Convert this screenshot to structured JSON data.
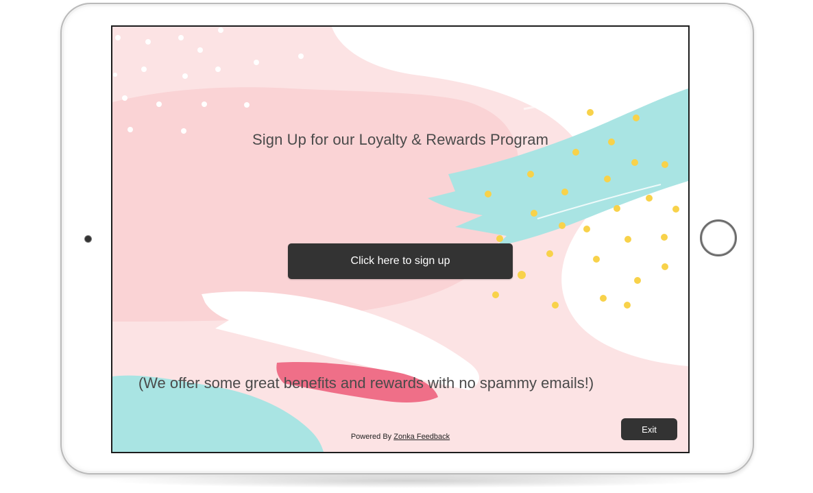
{
  "survey": {
    "title": "Sign Up for our Loyalty & Rewards Program",
    "cta_label": "Click here to sign up",
    "note": "(We offer some great benefits and rewards with no spammy emails!)",
    "exit_label": "Exit"
  },
  "footer": {
    "powered_by": "Powered By",
    "brand_link": "Zonka Feedback"
  },
  "colors": {
    "background_pink": "#fce3e4",
    "blob_pink": "#fad3d5",
    "teal": "#a9e4e3",
    "dots_yellow": "#f8d24a",
    "accent_pink": "#ef6f88",
    "button_dark": "#333333"
  },
  "icons": {
    "device_camera": "camera-icon",
    "device_home": "home-button-icon"
  }
}
